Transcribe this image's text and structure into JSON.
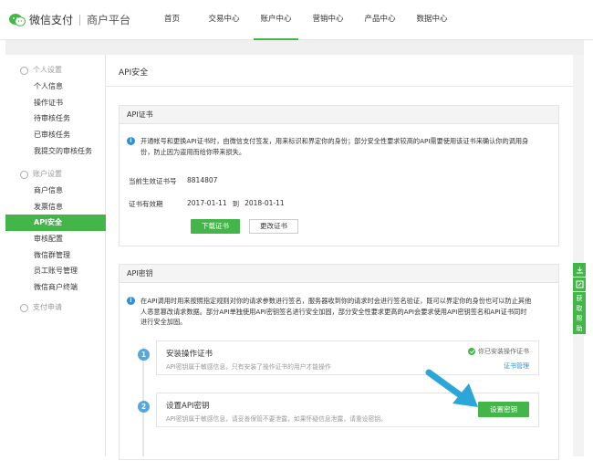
{
  "header": {
    "brand": "微信支付",
    "sub_brand": "商户平台",
    "nav": [
      {
        "label": "首页"
      },
      {
        "label": "交易中心"
      },
      {
        "label": "账户中心",
        "active": true
      },
      {
        "label": "营销中心"
      },
      {
        "label": "产品中心"
      },
      {
        "label": "数据中心"
      }
    ]
  },
  "sidebar": {
    "groups": [
      {
        "title": "个人设置",
        "icon": "user-icon",
        "items": [
          "个人信息",
          "操作证书",
          "待审核任务",
          "已审核任务",
          "我提交的审核任务"
        ]
      },
      {
        "title": "账户设置",
        "icon": "gear-icon",
        "items": [
          "商户信息",
          "发票信息",
          "API安全",
          "审核配置",
          "微信群管理",
          "员工账号管理",
          "微信商户终端"
        ]
      },
      {
        "title": "支付申请",
        "icon": "check-circle-icon",
        "items": []
      }
    ],
    "active_item": "API安全"
  },
  "main": {
    "title": "API安全",
    "cert_panel": {
      "title": "API证书",
      "info": "开通帐号和更换API证书时，由微信支付签发，用来标识和界定你的身份；部分安全性要求较高的API需要使用该证书来确认你的调用身份，防止因为盗用而给你带来损失。",
      "serial_label": "当前生效证书号",
      "serial_value": "8814807",
      "validity_label": "证书有效期",
      "validity_from": "2017-01-11",
      "validity_to_word": "到",
      "validity_to": "2018-01-11",
      "download_button": "下载证书",
      "change_button": "更改证书"
    },
    "key_panel": {
      "title": "API密钥",
      "info": "在API调用时用来按照指定规则对你的请求参数进行签名，服务器收到你的请求时会进行签名验证，既可以界定你的身份也可以防止其他人恶意篡改请求数据。部分API单独使用API密钥签名进行安全加固，部分安全性要求更高的API会要求使用API密钥签名和API证书同时进行安全加固。",
      "steps": [
        {
          "num": "1",
          "title": "安装操作证书",
          "desc": "API密钥属于敏感信息，只有安装了操作证书的用户才能操作",
          "status": "你已安装操作证书",
          "link": "证书管理"
        },
        {
          "num": "2",
          "title": "设置API密钥",
          "desc": "API密钥属于敏感信息，请妥善保管不要泄露，如果怀疑信息泄露，请重设密钥。",
          "button": "设置密钥"
        }
      ]
    }
  },
  "float_toolbar": {
    "help_label": "获取帮助"
  },
  "colors": {
    "accent": "#44b549",
    "info": "#2d8fd5",
    "step": "#56a7dc",
    "arrow": "#2aa6d9"
  }
}
